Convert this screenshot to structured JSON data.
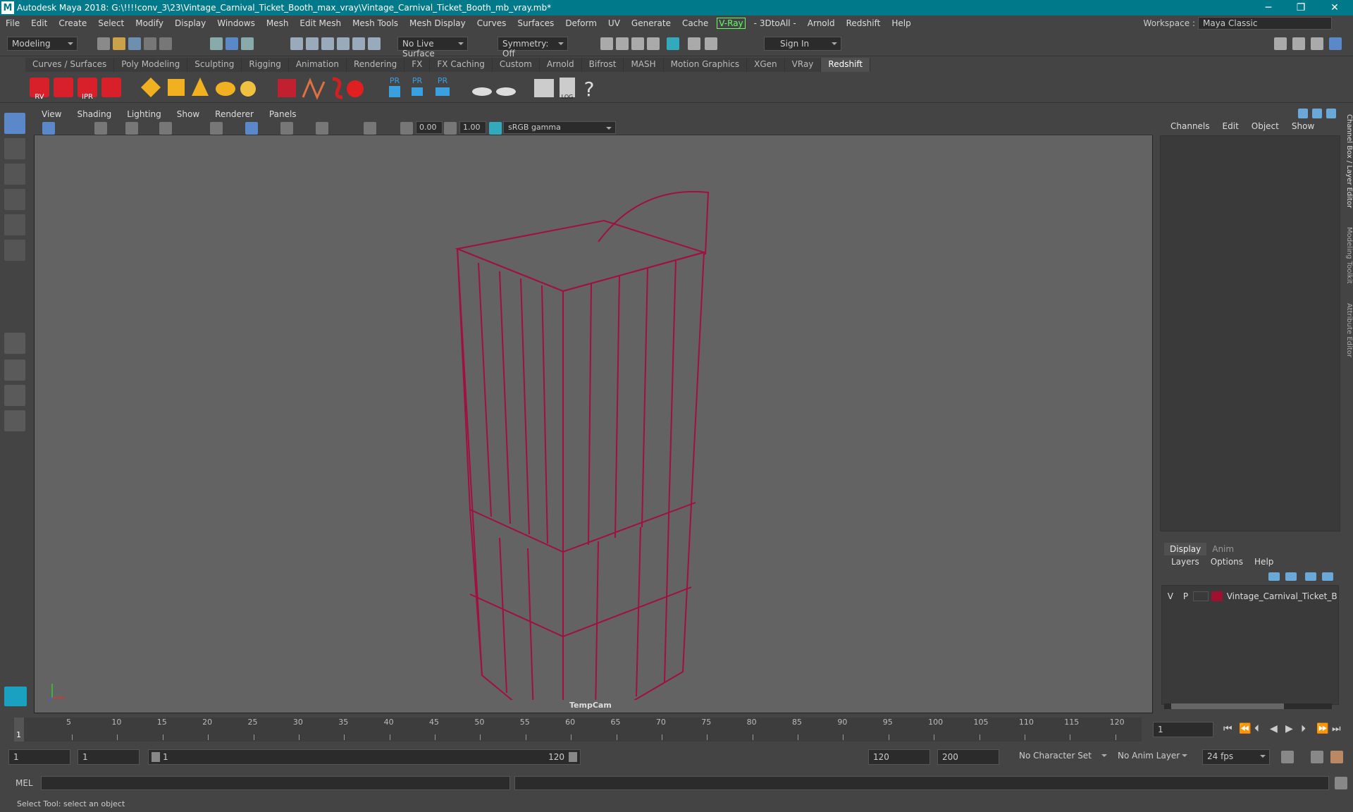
{
  "window": {
    "title": "Autodesk Maya 2018: G:\\!!!!conv_3\\23\\Vintage_Carnival_Ticket_Booth_max_vray\\Vintage_Carnival_Ticket_Booth_mb_vray.mb*",
    "logo": "M",
    "minimize": "─",
    "restore": "❐",
    "close": "✕"
  },
  "menu": {
    "items": [
      "File",
      "Edit",
      "Create",
      "Select",
      "Modify",
      "Display",
      "Windows",
      "Mesh",
      "Edit Mesh",
      "Mesh Tools",
      "Mesh Display",
      "Curves",
      "Surfaces",
      "Deform",
      "UV",
      "Generate",
      "Cache"
    ],
    "vray": "V-Ray",
    "items2": [
      "- 3DtoAll -",
      "Arnold",
      "Redshift",
      "Help"
    ],
    "workspace_label": "Workspace :",
    "workspace_value": "Maya Classic"
  },
  "status": {
    "mode": "Modeling",
    "live_surface": "No Live Surface",
    "symmetry": "Symmetry: Off",
    "sign_in": "Sign In"
  },
  "shelf": {
    "tabs": [
      "Curves / Surfaces",
      "Poly Modeling",
      "Sculpting",
      "Rigging",
      "Animation",
      "Rendering",
      "FX",
      "FX Caching",
      "Custom",
      "Arnold",
      "Bifrost",
      "MASH",
      "Motion Graphics",
      "XGen",
      "VRay",
      "Redshift"
    ],
    "active": "Redshift",
    "icon_labels": [
      "RV",
      "IPR",
      "PR",
      "PR",
      "PR",
      "LOG",
      "?"
    ]
  },
  "viewport": {
    "menu": [
      "View",
      "Shading",
      "Lighting",
      "Show",
      "Renderer",
      "Panels"
    ],
    "exposure": "0.00",
    "gamma": "1.00",
    "color_space": "sRGB gamma",
    "camera": "TempCam",
    "wire_color": "#a01040"
  },
  "channelbox": {
    "tabs": [
      "Channels",
      "Edit",
      "Object",
      "Show"
    ],
    "side_tabs": [
      "Channel Box / Layer Editor",
      "Modeling Toolkit",
      "Attribute Editor"
    ]
  },
  "layers": {
    "tabs": [
      "Display",
      "Anim"
    ],
    "active": "Display",
    "menu": [
      "Layers",
      "Options",
      "Help"
    ],
    "row": {
      "v": "V",
      "p": "P",
      "name": "Vintage_Carnival_Ticket_Booth",
      "color": "#a01030"
    }
  },
  "timeline": {
    "ticks": [
      "5",
      "10",
      "15",
      "20",
      "25",
      "30",
      "35",
      "40",
      "45",
      "50",
      "55",
      "60",
      "65",
      "70",
      "75",
      "80",
      "85",
      "90",
      "95",
      "100",
      "105",
      "110",
      "115",
      "120"
    ],
    "start_marker": "1",
    "current_frame": "1"
  },
  "range": {
    "start": "1",
    "anim_start": "1",
    "slider_start": "1",
    "slider_end": "120",
    "end": "120",
    "anim_end": "200",
    "character_set": "No Character Set",
    "anim_layer": "No Anim Layer",
    "fps": "24 fps"
  },
  "mel": {
    "label": "MEL"
  },
  "help": {
    "text": "Select Tool: select an object"
  }
}
